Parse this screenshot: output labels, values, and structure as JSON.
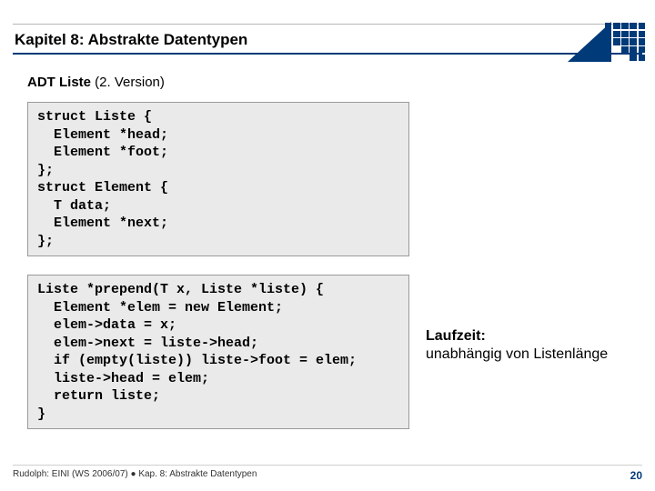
{
  "title": "Kapitel 8: Abstrakte Datentypen",
  "subtitle_bold": "ADT Liste",
  "subtitle_rest": " (2. Version)",
  "code1": "struct Liste {\n  Element *head;\n  Element *foot;\n};\nstruct Element {\n  T data;\n  Element *next;\n};",
  "code2": "Liste *prepend(T x, Liste *liste) {\n  Element *elem = new Element;\n  elem->data = x;\n  elem->next = liste->head;\n  if (empty(liste)) liste->foot = elem;\n  liste->head = elem;\n  return liste;\n}",
  "sidenote_bold": "Laufzeit:",
  "sidenote_rest": "unabhängig von Listenlänge",
  "footer_left": "Rudolph: EINI (WS 2006/07)  ●  Kap. 8: Abstrakte Datentypen",
  "page_number": "20"
}
